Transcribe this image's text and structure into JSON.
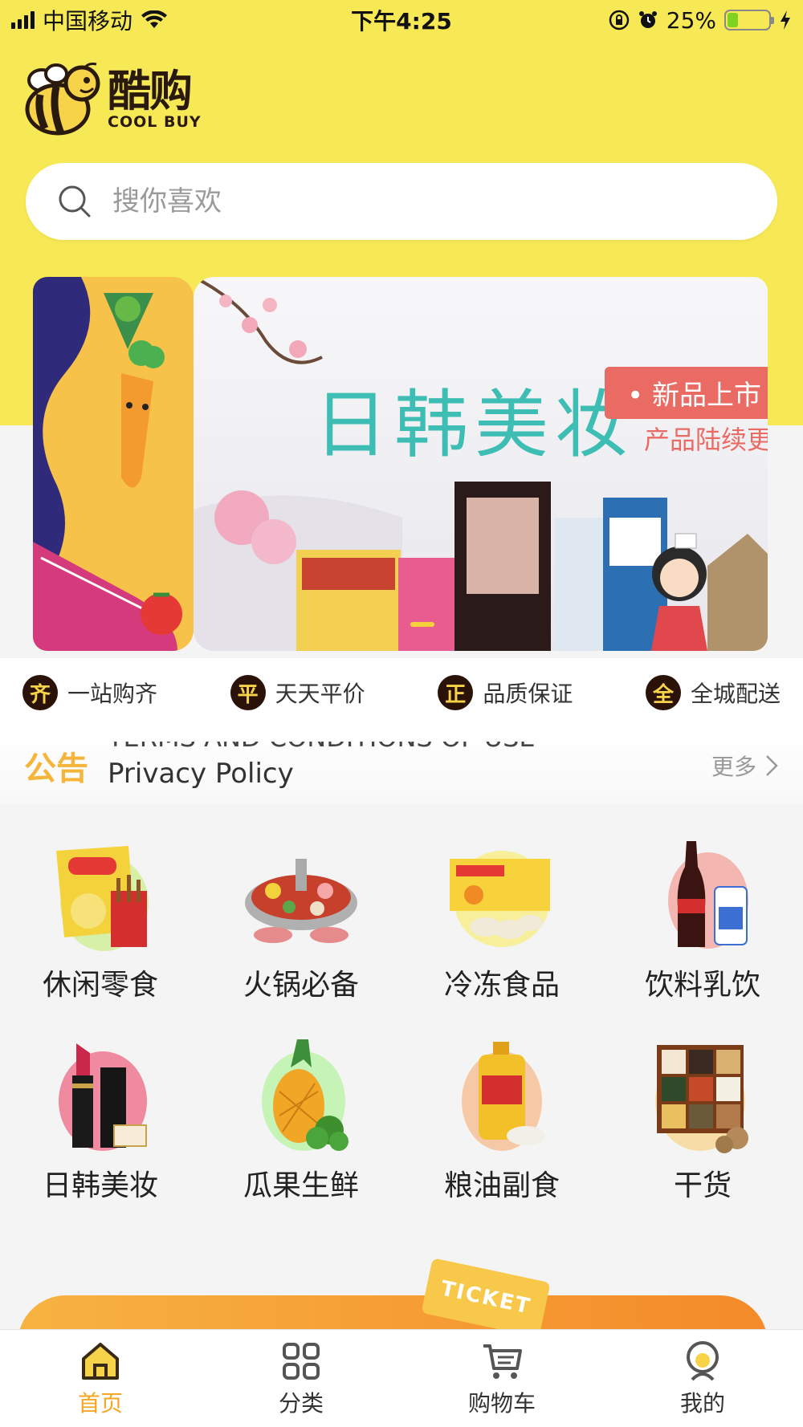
{
  "status_bar": {
    "carrier": "中国移动",
    "time": "下午4:25",
    "battery_percent": "25%",
    "battery_level": 0.25
  },
  "header": {
    "logo_cn": "酷购",
    "logo_en": "COOL BUY"
  },
  "search": {
    "placeholder": "搜你喜欢"
  },
  "banner": {
    "title": "日韩美妆",
    "tag": "• 新品上市",
    "subtitle": "产品陆续更"
  },
  "features": [
    {
      "badge": "齐",
      "label": "一站购齐"
    },
    {
      "badge": "平",
      "label": "天天平价"
    },
    {
      "badge": "正",
      "label": "品质保证"
    },
    {
      "badge": "全",
      "label": "全城配送"
    }
  ],
  "notice": {
    "label": "公告",
    "previous": "TERMS AND CONDITIONS OF USE",
    "current": "Privacy Policy",
    "more": "更多"
  },
  "categories": [
    {
      "label": "休闲零食",
      "icon": "snacks-icon"
    },
    {
      "label": "火锅必备",
      "icon": "hotpot-icon"
    },
    {
      "label": "冷冻食品",
      "icon": "frozen-food-icon"
    },
    {
      "label": "饮料乳饮",
      "icon": "drinks-icon"
    },
    {
      "label": "日韩美妆",
      "icon": "cosmetics-icon"
    },
    {
      "label": "瓜果生鲜",
      "icon": "fruit-icon"
    },
    {
      "label": "粮油副食",
      "icon": "grain-oil-icon"
    },
    {
      "label": "干货",
      "icon": "dried-goods-icon"
    }
  ],
  "coupon": {
    "ticket_label": "TICKET"
  },
  "tabbar": [
    {
      "label": "首页",
      "icon": "home-icon",
      "active": true
    },
    {
      "label": "分类",
      "icon": "category-icon",
      "active": false
    },
    {
      "label": "购物车",
      "icon": "cart-icon",
      "active": false
    },
    {
      "label": "我的",
      "icon": "profile-icon",
      "active": false
    }
  ],
  "colors": {
    "brand_yellow": "#f7e955",
    "accent_orange": "#f5a623",
    "banner_teal": "#3dbdb3"
  }
}
